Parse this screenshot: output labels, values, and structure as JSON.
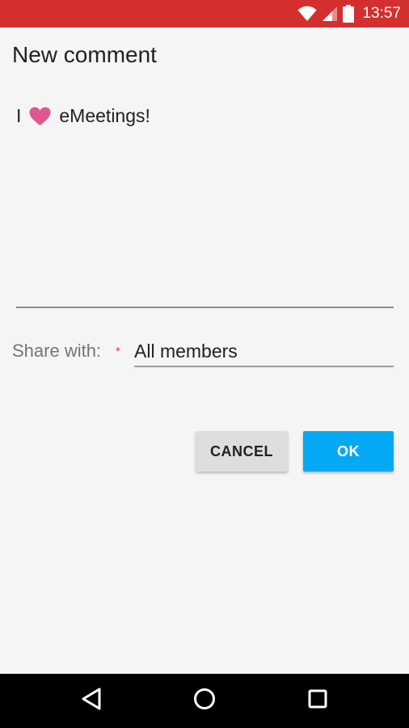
{
  "status_bar": {
    "time": "13:57",
    "icons": [
      "wifi-icon",
      "signal-icon",
      "battery-icon"
    ],
    "color": "#d32f2f"
  },
  "dialog": {
    "title": "New comment",
    "comment": {
      "prefix": "I",
      "icon": "heart-icon",
      "suffix": "eMeetings!"
    },
    "share": {
      "label": "Share with:",
      "required_mark": "*",
      "selected_value": "All members"
    },
    "buttons": {
      "cancel_label": "CANCEL",
      "ok_label": "OK"
    },
    "accent_color": "#03a9f4",
    "heart_color": "#e0578f"
  },
  "nav_bar": {
    "icons": [
      "back-icon",
      "home-icon",
      "recents-icon"
    ]
  }
}
